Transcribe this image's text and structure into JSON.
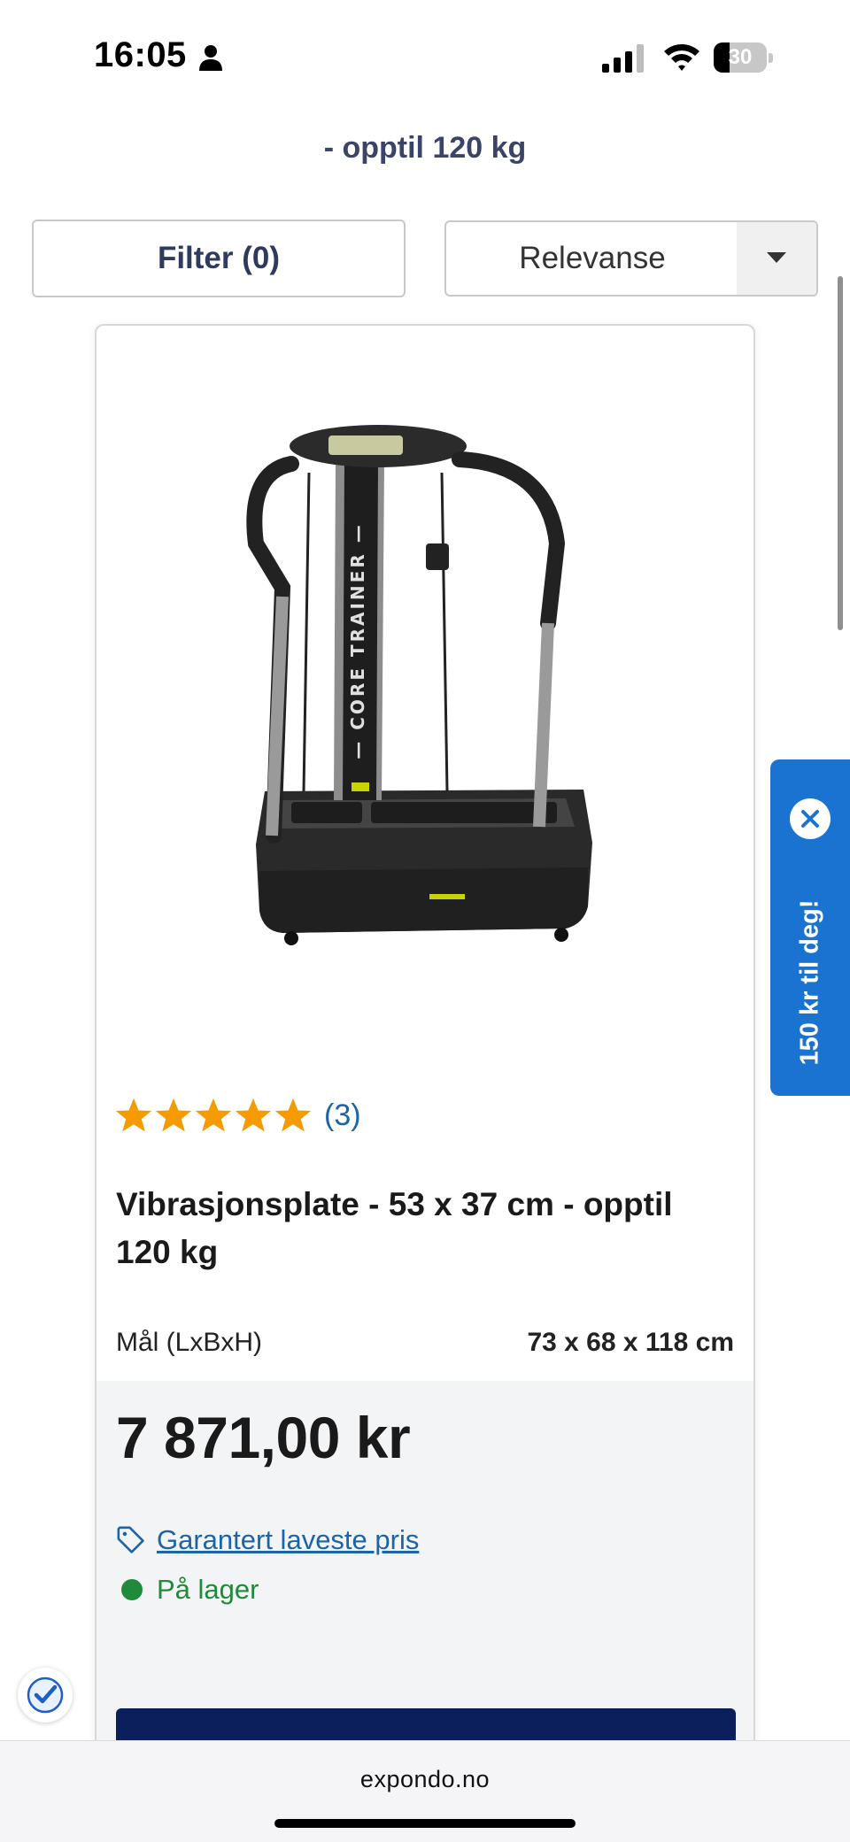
{
  "status_bar": {
    "time": "16:05",
    "battery_level": "30",
    "battery_fraction": 0.3,
    "icons": [
      "person-icon",
      "signal-icon",
      "wifi-icon",
      "battery-icon"
    ]
  },
  "category_heading": {
    "visible_line": "- opptil 120 kg"
  },
  "controls": {
    "filter_label": "Filter (0)",
    "sort_selected": "Relevanse",
    "sort_icon": "chevron-down-icon"
  },
  "product": {
    "rating_stars": 5,
    "rating_count": "(3)",
    "title": "Vibrasjonsplate - 53 x 37 cm - opptil 120 kg",
    "spec_label": "Mål (LxBxH)",
    "spec_value": "73 x 68 x 118 cm",
    "price": "7 871,00 kr",
    "guarantee_link": "Garantert laveste pris",
    "stock_status": "På lager",
    "image_icon": "vibration-plate-image"
  },
  "promo": {
    "text": "150 kr til deg!",
    "close_icon": "close-icon"
  },
  "browser": {
    "url": "expondo.no"
  },
  "colors": {
    "brand_navy": "#0b1f5c",
    "link_blue": "#1c64a8",
    "promo_blue": "#1a73d1",
    "stock_green": "#1f8a3a",
    "star_orange": "#f59b00"
  }
}
